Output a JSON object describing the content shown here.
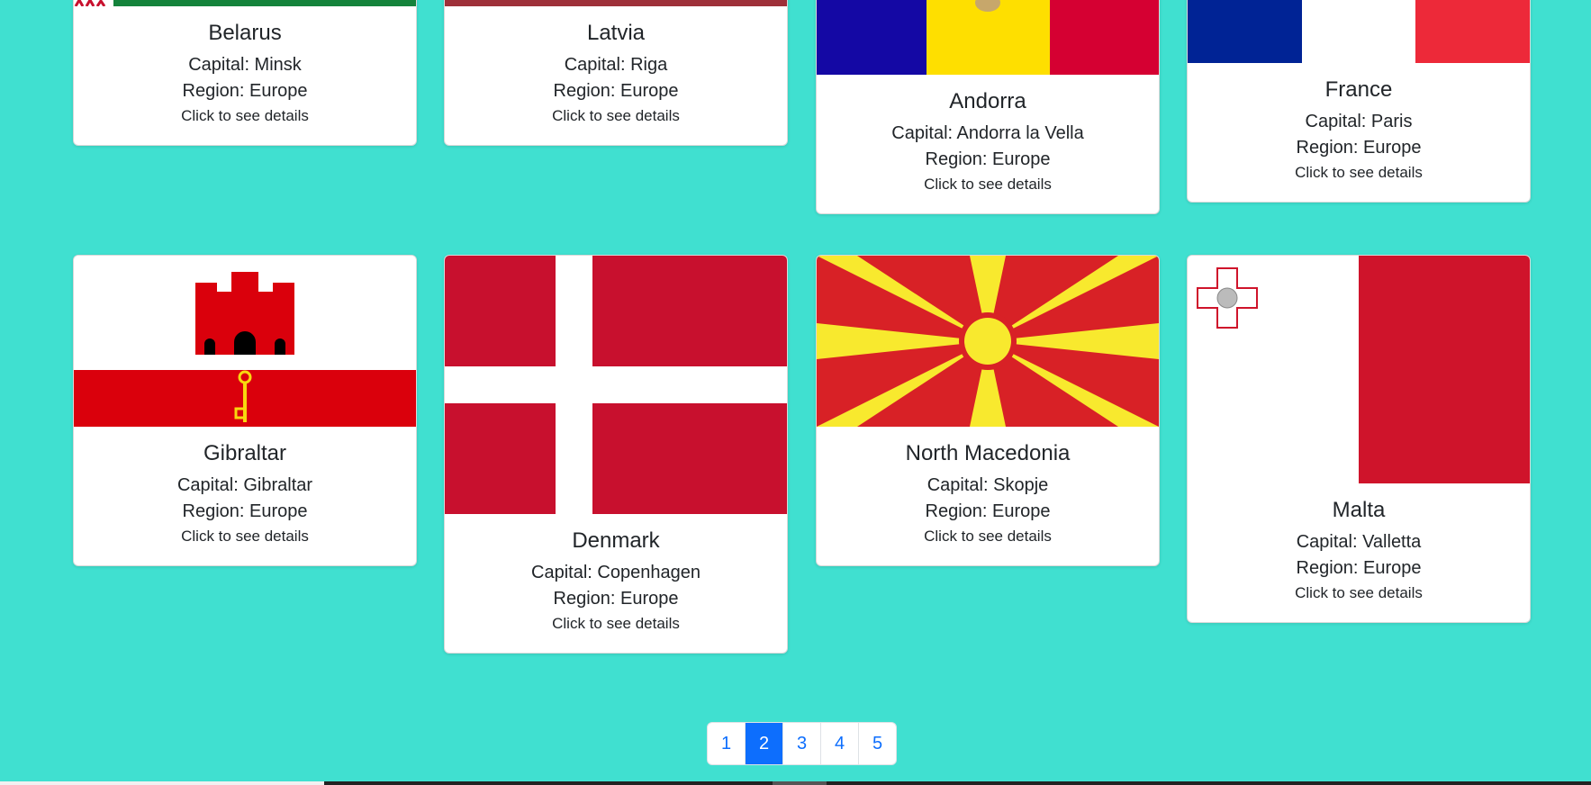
{
  "cards": [
    {
      "name": "Belarus",
      "capital": "Capital: Minsk",
      "region": "Region: Europe",
      "cta": "Click to see details"
    },
    {
      "name": "Latvia",
      "capital": "Capital: Riga",
      "region": "Region: Europe",
      "cta": "Click to see details"
    },
    {
      "name": "Andorra",
      "capital": "Capital: Andorra la Vella",
      "region": "Region: Europe",
      "cta": "Click to see details"
    },
    {
      "name": "France",
      "capital": "Capital: Paris",
      "region": "Region: Europe",
      "cta": "Click to see details"
    },
    {
      "name": "Gibraltar",
      "capital": "Capital: Gibraltar",
      "region": "Region: Europe",
      "cta": "Click to see details"
    },
    {
      "name": "Denmark",
      "capital": "Capital: Copenhagen",
      "region": "Region: Europe",
      "cta": "Click to see details"
    },
    {
      "name": "North Macedonia",
      "capital": "Capital: Skopje",
      "region": "Region: Europe",
      "cta": "Click to see details"
    },
    {
      "name": "Malta",
      "capital": "Capital: Valletta",
      "region": "Region: Europe",
      "cta": "Click to see details"
    }
  ],
  "pagination": {
    "pages": [
      "1",
      "2",
      "3",
      "4",
      "5"
    ],
    "active": "2"
  },
  "colors": {
    "background": "#40e0d0",
    "accent": "#0d6efd"
  }
}
